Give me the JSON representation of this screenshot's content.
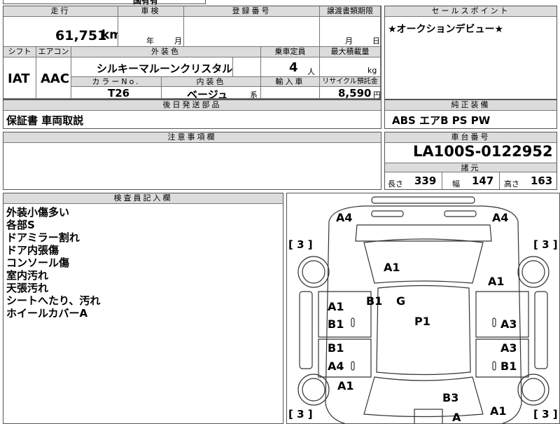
{
  "top_partial": "国有有",
  "headers": {
    "mileage": "走行",
    "inspection": "車検",
    "registration": "登録番号",
    "transfer_deadline": "譲渡書類期限",
    "sales_point": "セールスポイント",
    "shift": "シフト",
    "aircon": "エアコン",
    "exterior_color": "外装色",
    "capacity": "乗車定員",
    "max_load": "最大積載量",
    "color_no": "カラーNo.",
    "interior_color": "内装色",
    "import": "輸入車",
    "recycle": "リサイクル預託金",
    "later_parts": "後日発送部品",
    "genuine_equipment": "純正装備",
    "caution": "注意事項欄",
    "chassis_no": "車台番号",
    "specs": "諸元",
    "inspector": "検査員記入欄"
  },
  "mileage": {
    "value": "61,751",
    "unit": "km"
  },
  "inspection": {
    "year_label": "年",
    "month_label": "月"
  },
  "transfer": {
    "month_label": "月",
    "day_label": "日"
  },
  "sales_point_text": "★オークションデビュー★",
  "shift_value": "IAT",
  "aircon_value": "AAC",
  "exterior_color_value": "シルキーマルーンクリスタルM",
  "capacity": {
    "value": "4",
    "unit": "人"
  },
  "max_load_unit": "kg",
  "color_no_value": "T26",
  "interior_color": {
    "value": "ベージュ",
    "suffix": "系"
  },
  "recycle": {
    "value": "8,590",
    "unit": "円"
  },
  "later_parts_text": "保証書 車両取説",
  "genuine_equipment_text": "ABS エアB PS PW",
  "chassis_no_value": "LA100S-0122952",
  "specs": {
    "length_label": "長さ",
    "length": "339",
    "width_label": "幅",
    "width": "147",
    "height_label": "高さ",
    "height": "163"
  },
  "inspector_notes": [
    "外装小傷多い",
    "各部S",
    "ドアミラー割れ",
    "ドア内張傷",
    "コンソール傷",
    "室内汚れ",
    "天張汚れ",
    "シートへたり、汚れ",
    "ホイールカバーA"
  ],
  "diagram": {
    "tire_marks": [
      "[ 3 ]",
      "[ 3 ]",
      "[ 3 ]",
      "[ 3 ]"
    ],
    "labels": [
      "A4",
      "A4",
      "A1",
      "A1",
      "A1",
      "B1",
      "G",
      "B1",
      "P1",
      "A3",
      "B1",
      "A3",
      "A4",
      "B1",
      "A1",
      "B3",
      "A1",
      "A"
    ]
  }
}
